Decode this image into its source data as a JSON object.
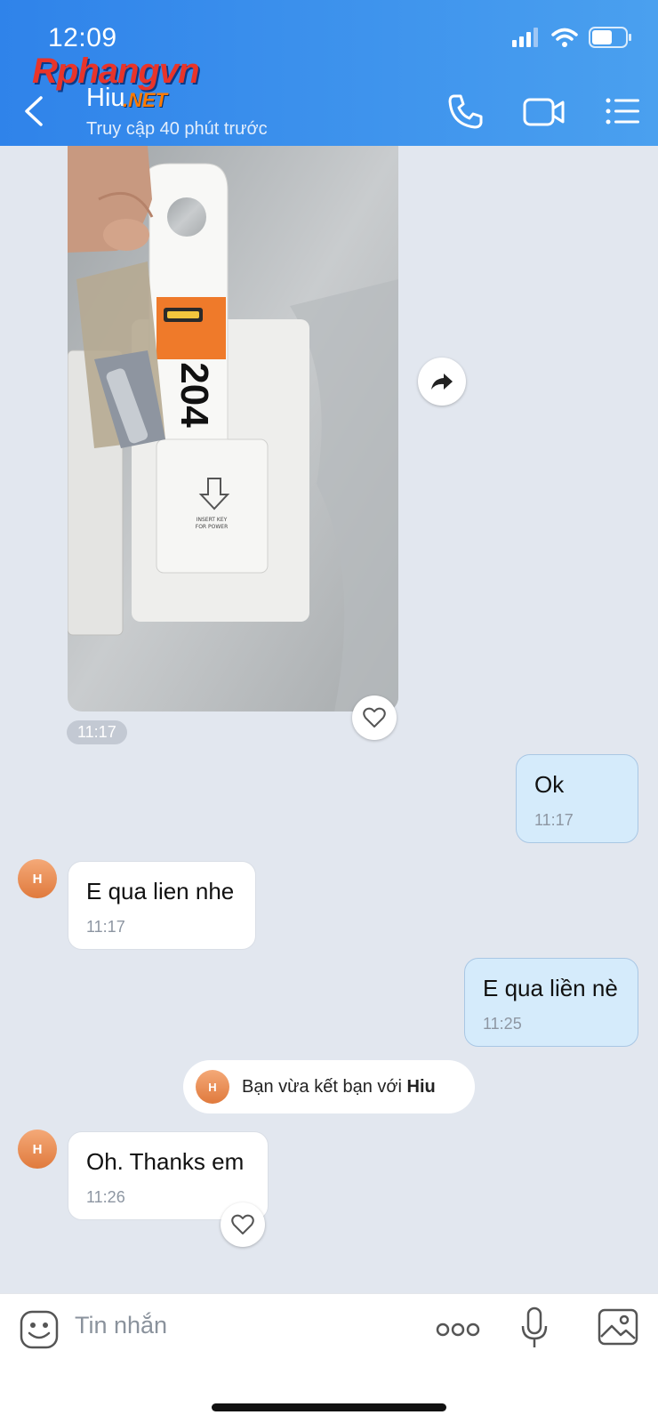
{
  "status_bar": {
    "time": "12:09"
  },
  "watermark": {
    "main": "Rphangvn",
    "suffix": ".NET"
  },
  "header": {
    "contact_name": "Hiu",
    "contact_status": "Truy cập 40 phút trước"
  },
  "photo_message": {
    "room_number": "204",
    "time": "11:17"
  },
  "messages": [
    {
      "direction": "out",
      "text": "Ok",
      "time": "11:17"
    },
    {
      "direction": "in",
      "avatar": "H",
      "text": "E qua lien nhe",
      "time": "11:17"
    },
    {
      "direction": "out",
      "text": "E qua liền nè",
      "time": "11:25"
    },
    {
      "direction": "in",
      "avatar": "H",
      "text": "Oh. Thanks em",
      "time": "11:26"
    }
  ],
  "system_notice": {
    "avatar": "H",
    "prefix": "Bạn vừa kết bạn với ",
    "name": "Hiu"
  },
  "input_bar": {
    "placeholder": "Tin nhắn"
  },
  "colors": {
    "header": "#3a8fec",
    "outgoing_bubble": "#d5ebfb",
    "background": "#e2e7ef"
  }
}
